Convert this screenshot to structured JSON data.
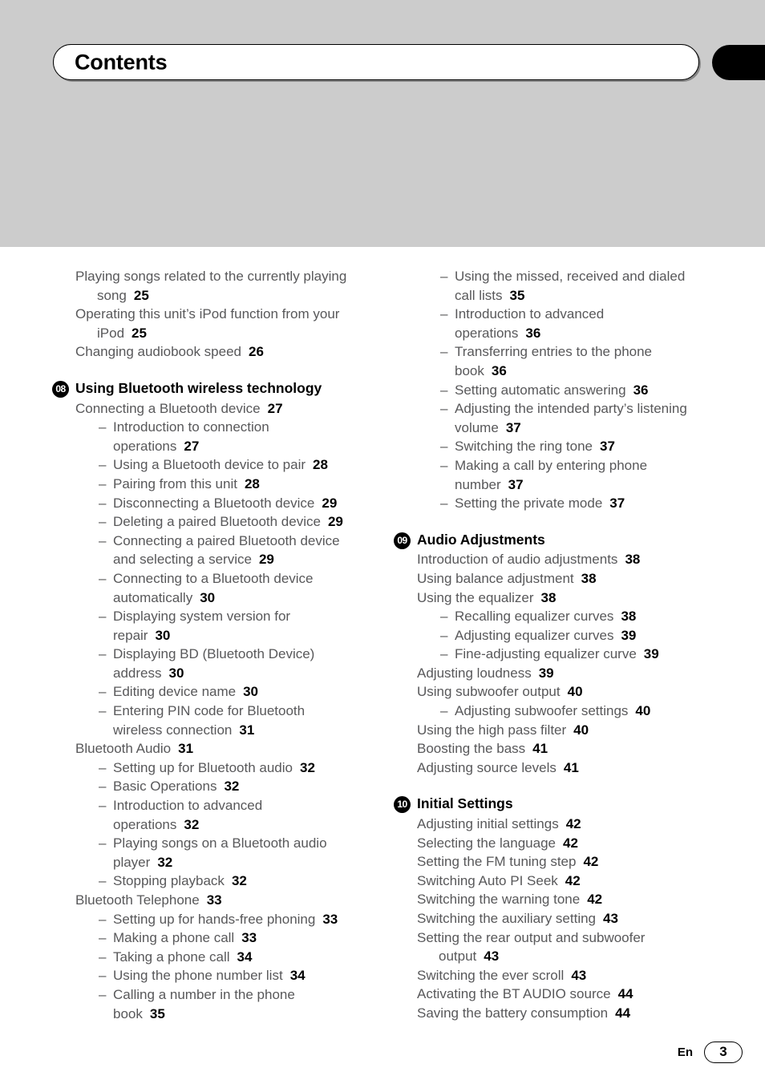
{
  "header": {
    "title": "Contents",
    "edge_tab_color": "#000000"
  },
  "footer": {
    "language": "En",
    "page_number": "3"
  },
  "colors": {
    "band_gray": "#cccccc",
    "body_text": "#58585a",
    "page_number_text": "#000000"
  },
  "left_column": [
    {
      "level": 1,
      "lines": [
        "Playing songs related to the currently playing",
        "song"
      ],
      "page": "25"
    },
    {
      "level": 1,
      "lines": [
        "Operating this unit’s iPod function from your",
        "iPod"
      ],
      "page": "25"
    },
    {
      "level": 1,
      "lines": [
        "Changing audiobook speed"
      ],
      "page": "26"
    },
    {
      "chapter": true,
      "number": "08",
      "title": "Using Bluetooth wireless technology"
    },
    {
      "level": 1,
      "lines": [
        "Connecting a Bluetooth device"
      ],
      "page": "27"
    },
    {
      "level": 2,
      "lines": [
        "Introduction to connection",
        "operations"
      ],
      "page": "27"
    },
    {
      "level": 2,
      "lines": [
        "Using a Bluetooth device to pair"
      ],
      "page": "28"
    },
    {
      "level": 2,
      "lines": [
        "Pairing from this unit"
      ],
      "page": "28"
    },
    {
      "level": 2,
      "lines": [
        "Disconnecting a Bluetooth device"
      ],
      "page": "29"
    },
    {
      "level": 2,
      "lines": [
        "Deleting a paired Bluetooth device"
      ],
      "page": "29"
    },
    {
      "level": 2,
      "lines": [
        "Connecting a paired Bluetooth device",
        "and selecting a service"
      ],
      "page": "29"
    },
    {
      "level": 2,
      "lines": [
        "Connecting to a Bluetooth device",
        "automatically"
      ],
      "page": "30"
    },
    {
      "level": 2,
      "lines": [
        "Displaying system version for",
        "repair"
      ],
      "page": "30"
    },
    {
      "level": 2,
      "lines": [
        "Displaying BD (Bluetooth Device)",
        "address"
      ],
      "page": "30"
    },
    {
      "level": 2,
      "lines": [
        "Editing device name"
      ],
      "page": "30"
    },
    {
      "level": 2,
      "lines": [
        "Entering PIN code for Bluetooth",
        "wireless connection"
      ],
      "page": "31"
    },
    {
      "level": 1,
      "lines": [
        "Bluetooth Audio"
      ],
      "page": "31"
    },
    {
      "level": 2,
      "lines": [
        "Setting up for Bluetooth audio"
      ],
      "page": "32"
    },
    {
      "level": 2,
      "lines": [
        "Basic Operations"
      ],
      "page": "32"
    },
    {
      "level": 2,
      "lines": [
        "Introduction to advanced",
        "operations"
      ],
      "page": "32"
    },
    {
      "level": 2,
      "lines": [
        "Playing songs on a Bluetooth audio",
        "player"
      ],
      "page": "32"
    },
    {
      "level": 2,
      "lines": [
        "Stopping playback"
      ],
      "page": "32"
    },
    {
      "level": 1,
      "lines": [
        "Bluetooth Telephone"
      ],
      "page": "33"
    },
    {
      "level": 2,
      "lines": [
        "Setting up for hands-free phoning"
      ],
      "page": "33"
    },
    {
      "level": 2,
      "lines": [
        "Making a phone call"
      ],
      "page": "33"
    },
    {
      "level": 2,
      "lines": [
        "Taking a phone call"
      ],
      "page": "34"
    },
    {
      "level": 2,
      "lines": [
        "Using the phone number list"
      ],
      "page": "34"
    },
    {
      "level": 2,
      "lines": [
        "Calling a number in the phone",
        "book"
      ],
      "page": "35"
    }
  ],
  "right_column": [
    {
      "level": 2,
      "lines": [
        "Using the missed, received and dialed",
        "call lists"
      ],
      "page": "35"
    },
    {
      "level": 2,
      "lines": [
        "Introduction to advanced",
        "operations"
      ],
      "page": "36"
    },
    {
      "level": 2,
      "lines": [
        "Transferring entries to the phone",
        "book"
      ],
      "page": "36"
    },
    {
      "level": 2,
      "lines": [
        "Setting automatic answering"
      ],
      "page": "36"
    },
    {
      "level": 2,
      "lines": [
        "Adjusting the intended party’s listening",
        "volume"
      ],
      "page": "37"
    },
    {
      "level": 2,
      "lines": [
        "Switching the ring tone"
      ],
      "page": "37"
    },
    {
      "level": 2,
      "lines": [
        "Making a call by entering phone",
        "number"
      ],
      "page": "37"
    },
    {
      "level": 2,
      "lines": [
        "Setting the private mode"
      ],
      "page": "37"
    },
    {
      "chapter": true,
      "number": "09",
      "title": "Audio Adjustments"
    },
    {
      "level": 1,
      "lines": [
        "Introduction of audio adjustments"
      ],
      "page": "38"
    },
    {
      "level": 1,
      "lines": [
        "Using balance adjustment"
      ],
      "page": "38"
    },
    {
      "level": 1,
      "lines": [
        "Using the equalizer"
      ],
      "page": "38"
    },
    {
      "level": 2,
      "lines": [
        "Recalling equalizer curves"
      ],
      "page": "38"
    },
    {
      "level": 2,
      "lines": [
        "Adjusting equalizer curves"
      ],
      "page": "39"
    },
    {
      "level": 2,
      "lines": [
        "Fine-adjusting equalizer curve"
      ],
      "page": "39"
    },
    {
      "level": 1,
      "lines": [
        "Adjusting loudness"
      ],
      "page": "39"
    },
    {
      "level": 1,
      "lines": [
        "Using subwoofer output"
      ],
      "page": "40"
    },
    {
      "level": 2,
      "lines": [
        "Adjusting subwoofer settings"
      ],
      "page": "40"
    },
    {
      "level": 1,
      "lines": [
        "Using the high pass filter"
      ],
      "page": "40"
    },
    {
      "level": 1,
      "lines": [
        "Boosting the bass"
      ],
      "page": "41"
    },
    {
      "level": 1,
      "lines": [
        "Adjusting source levels"
      ],
      "page": "41"
    },
    {
      "chapter": true,
      "number": "10",
      "title": "Initial Settings"
    },
    {
      "level": 1,
      "lines": [
        "Adjusting initial settings"
      ],
      "page": "42"
    },
    {
      "level": 1,
      "lines": [
        "Selecting the language"
      ],
      "page": "42"
    },
    {
      "level": 1,
      "lines": [
        "Setting the FM tuning step"
      ],
      "page": "42"
    },
    {
      "level": 1,
      "lines": [
        "Switching Auto PI Seek"
      ],
      "page": "42"
    },
    {
      "level": 1,
      "lines": [
        "Switching the warning tone"
      ],
      "page": "42"
    },
    {
      "level": 1,
      "lines": [
        "Switching the auxiliary setting"
      ],
      "page": "43"
    },
    {
      "level": 1,
      "lines": [
        "Setting the rear output and subwoofer",
        "output"
      ],
      "page": "43"
    },
    {
      "level": 1,
      "lines": [
        "Switching the ever scroll"
      ],
      "page": "43"
    },
    {
      "level": 1,
      "lines": [
        "Activating the BT AUDIO source"
      ],
      "page": "44"
    },
    {
      "level": 1,
      "lines": [
        "Saving the battery consumption"
      ],
      "page": "44"
    }
  ]
}
